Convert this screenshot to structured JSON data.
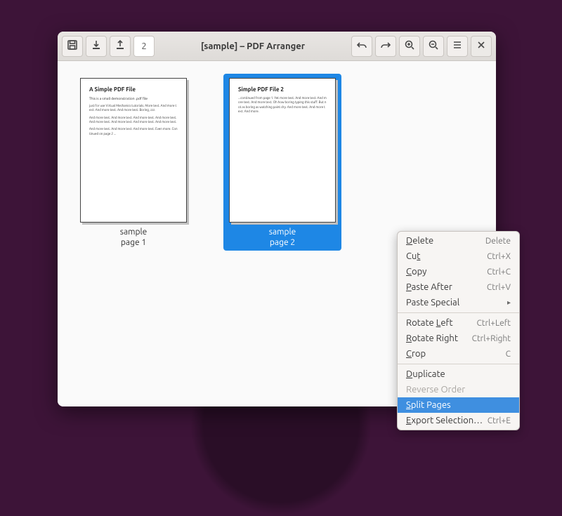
{
  "window": {
    "title": "[sample] – PDF Arranger",
    "page_entry": "2"
  },
  "toolbar": {
    "save_tip": "Save",
    "import_tip": "Import",
    "export_tip": "Export",
    "undo_tip": "Undo",
    "redo_tip": "Redo",
    "zoom_in_tip": "Zoom In",
    "zoom_out_tip": "Zoom Out",
    "menu_tip": "Menu",
    "close_tip": "Close"
  },
  "thumbs": [
    {
      "title": "A Simple PDF File",
      "subtitle": "This is a small demonstration .pdf file",
      "paras": [
        "just for use Virtual Mechanics tutorials. More text. And more text. And more text. And more text. Boring, zzz.",
        "And more text. And more text. And more text. And more text. And more text. And more text. And more text. And more text.",
        "And more text. And more text. And more text. Even more. Continued on page 2 ..."
      ],
      "caption_name": "sample",
      "caption_page": "page 1",
      "selected": false
    },
    {
      "title": "Simple PDF File 2",
      "subtitle": "",
      "paras": [
        "...continued from page 1. Yet more text. And more text. And more text. And more text. Oh how boring typing this stuff. But not as boring as watching paint dry. And more text. And more text. And more."
      ],
      "caption_name": "sample",
      "caption_page": "page 2",
      "selected": true
    }
  ],
  "context_menu": [
    {
      "label": "Delete",
      "ul": 0,
      "accel": "Delete",
      "kind": "item"
    },
    {
      "label": "Cut",
      "ul": 2,
      "accel": "Ctrl+X",
      "kind": "item"
    },
    {
      "label": "Copy",
      "ul": 0,
      "accel": "Ctrl+C",
      "kind": "item"
    },
    {
      "label": "Paste After",
      "ul": 0,
      "accel": "Ctrl+V",
      "kind": "item"
    },
    {
      "label": "Paste Special",
      "ul": -1,
      "accel": "",
      "kind": "submenu"
    },
    {
      "kind": "sep"
    },
    {
      "label": "Rotate Left",
      "ul": 7,
      "accel": "Ctrl+Left",
      "kind": "item"
    },
    {
      "label": "Rotate Right",
      "ul": 0,
      "accel": "Ctrl+Right",
      "kind": "item"
    },
    {
      "label": "Crop",
      "ul": 0,
      "accel": "C",
      "kind": "item"
    },
    {
      "kind": "sep"
    },
    {
      "label": "Duplicate",
      "ul": 0,
      "accel": "",
      "kind": "item"
    },
    {
      "label": "Reverse Order",
      "ul": -1,
      "accel": "",
      "kind": "disabled"
    },
    {
      "label": "Split Pages",
      "ul": 0,
      "accel": "",
      "kind": "highlight"
    },
    {
      "label": "Export Selection…",
      "ul": 0,
      "accel": "Ctrl+E",
      "kind": "item"
    }
  ]
}
